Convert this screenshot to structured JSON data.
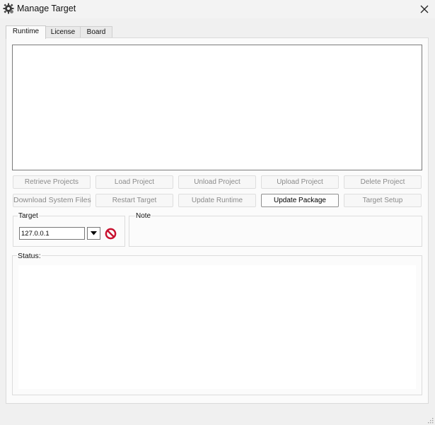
{
  "window": {
    "title": "Manage Target",
    "icon": "gear-icon",
    "close_icon": "close-icon"
  },
  "tabs": [
    {
      "label": "Runtime",
      "active": true
    },
    {
      "label": "License",
      "active": false
    },
    {
      "label": "Board",
      "active": false
    }
  ],
  "buttons": {
    "retrieve_projects": {
      "label": "Retrieve Projects",
      "enabled": false
    },
    "load_project": {
      "label": "Load Project",
      "enabled": false
    },
    "unload_project": {
      "label": "Unload Project",
      "enabled": false
    },
    "upload_project": {
      "label": "Upload Project",
      "enabled": false
    },
    "delete_project": {
      "label": "Delete Project",
      "enabled": false
    },
    "download_system_files": {
      "label": "Download System Files",
      "enabled": false
    },
    "restart_target": {
      "label": "Restart Target",
      "enabled": false
    },
    "update_runtime": {
      "label": "Update Runtime",
      "enabled": false
    },
    "update_package": {
      "label": "Update Package",
      "enabled": true
    },
    "target_setup": {
      "label": "Target Setup",
      "enabled": false
    }
  },
  "target": {
    "label": "Target",
    "address": "127.0.0.1",
    "dropdown_icon": "chevron-down-icon",
    "disconnect_icon": "no-entry-icon"
  },
  "note": {
    "label": "Note"
  },
  "status": {
    "label": "Status:"
  },
  "colors": {
    "stop_red": "#c8102e",
    "panel_bg": "#fbfbfb",
    "window_bg": "#f0f0f0"
  }
}
